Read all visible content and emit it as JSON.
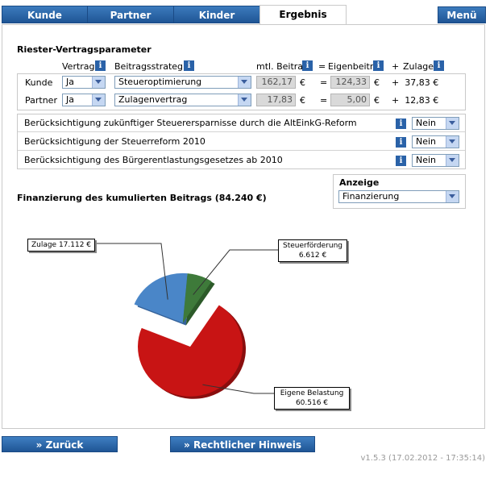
{
  "tabs": [
    {
      "label": "Kunde"
    },
    {
      "label": "Partner"
    },
    {
      "label": "Kinder"
    },
    {
      "label": "Ergebnis",
      "active": true
    }
  ],
  "menu_label": "Menü",
  "params": {
    "title": "Riester-Vertragsparameter",
    "headers": {
      "vertrag": "Vertrag",
      "strategie": "Beitragsstrategie",
      "beitrag": "mtl. Beitrag",
      "eq": "=",
      "eigen": "Eigenbeitr.",
      "plus": "+",
      "zulage": "Zulage"
    },
    "rows": [
      {
        "name": "Kunde",
        "vertrag": "Ja",
        "strategie": "Steueroptimierung",
        "beitrag": "162,17",
        "cur1": "€",
        "eq": "=",
        "eigen": "124,33",
        "cur2": "€",
        "zulage": "+  37,83 €"
      },
      {
        "name": "Partner",
        "vertrag": "Ja",
        "strategie": "Zulagenvertrag",
        "beitrag": "17,83",
        "cur1": "€",
        "eq": "=",
        "eigen": "5,00",
        "cur2": "€",
        "zulage": "+  12,83 €"
      }
    ]
  },
  "options": [
    {
      "label": "Berücksichtigung zukünftiger Steuerersparnisse durch die AltEinkG-Reform",
      "value": "Nein"
    },
    {
      "label": "Berücksichtigung der Steuerreform 2010",
      "value": "Nein"
    },
    {
      "label": "Berücksichtigung des Bürgerentlastungsgesetzes ab 2010",
      "value": "Nein"
    }
  ],
  "anzeige": {
    "label": "Anzeige",
    "value": "Finanzierung"
  },
  "financing_title": "Finanzierung des kumulierten Beitrags (84.240 €)",
  "chart_data": {
    "type": "pie",
    "title": "",
    "slices": [
      {
        "label": "Zulage",
        "value": 17112,
        "display": "Zulage 17.112 €",
        "color": "#4a86c8"
      },
      {
        "label": "Steuerförderung",
        "value": 6612,
        "display_line1": "Steuerförderung",
        "display_line2": "6.612 €",
        "color": "#3e7a3a"
      },
      {
        "label": "Eigene Belastung",
        "value": 60516,
        "display_line1": "Eigene Belastung",
        "display_line2": "60.516 €",
        "color": "#c81414"
      }
    ]
  },
  "buttons": {
    "back": "Zurück",
    "legal": "Rechtlicher Hinweis"
  },
  "version": "v1.5.3 (17.02.2012 - 17:35:14)"
}
